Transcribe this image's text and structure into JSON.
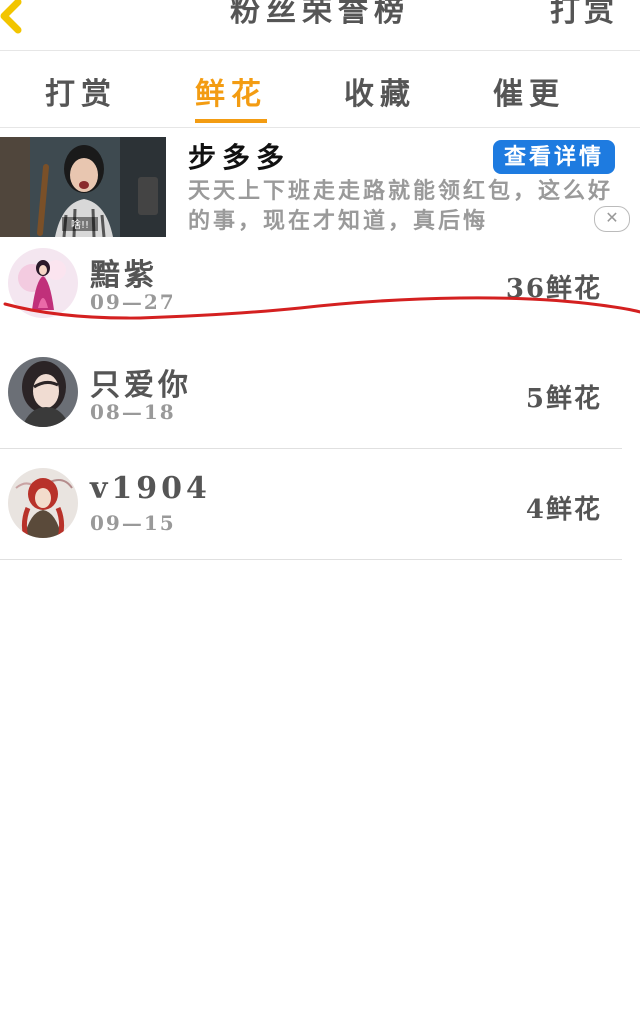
{
  "header": {
    "title": "粉丝荣誉榜",
    "action": "打赏"
  },
  "tabs": [
    {
      "label": "打赏",
      "active": false
    },
    {
      "label": "鲜花",
      "active": true
    },
    {
      "label": "收藏",
      "active": false
    },
    {
      "label": "催更",
      "active": false
    }
  ],
  "ad": {
    "name": "步多多",
    "detail_button": "查看详情",
    "description": "天天上下班走走路就能领红包，这么好的事，现在才知道，真后悔",
    "image_caption": "啥!!"
  },
  "fans": [
    {
      "name": "黯紫",
      "date": "09—27",
      "count": "36鲜花"
    },
    {
      "name": "只爱你",
      "date": "08—18",
      "count": "5鲜花"
    },
    {
      "name": "v1904",
      "date": "09—15",
      "count": "4鲜花"
    }
  ],
  "colors": {
    "accent": "#f39c12",
    "ad_button": "#1e7be0",
    "annotation": "#d42020"
  }
}
